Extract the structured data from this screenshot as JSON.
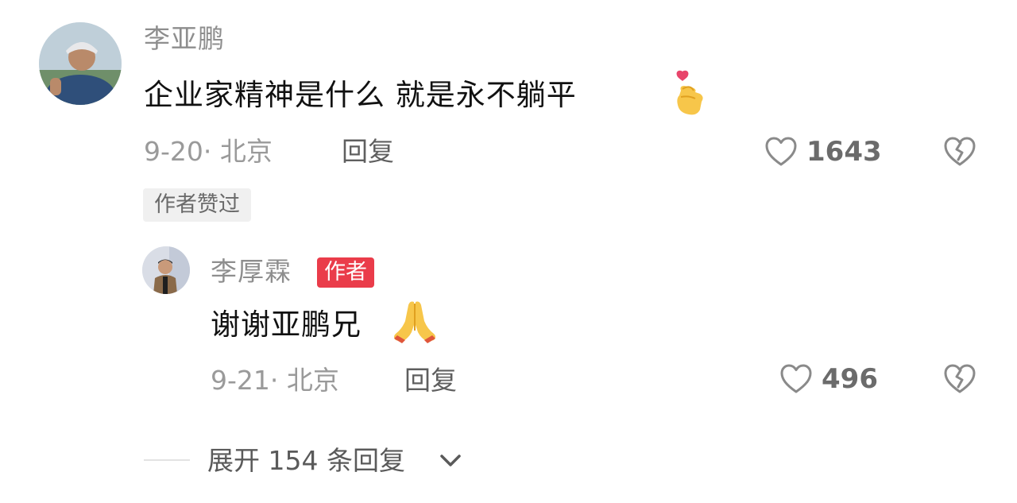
{
  "comment": {
    "author": "李亚鹏",
    "text": "企业家精神是什么  就是永不躺平",
    "emoji": "finger-heart-emoji",
    "date_location": "9-20· 北京",
    "reply_label": "回复",
    "like_count": "1643",
    "liked_by_author_badge": "作者赞过"
  },
  "reply": {
    "author": "李厚霖",
    "author_badge": "作者",
    "text": "谢谢亚鹏兄",
    "emoji": "folded-hands-emoji",
    "date_location": "9-21· 北京",
    "reply_label": "回复",
    "like_count": "496"
  },
  "expand": {
    "label": "展开 154 条回复"
  },
  "colors": {
    "author_badge_bg": "#ea3c4a",
    "muted_text": "#8e8e8e",
    "body_text": "#111111"
  }
}
